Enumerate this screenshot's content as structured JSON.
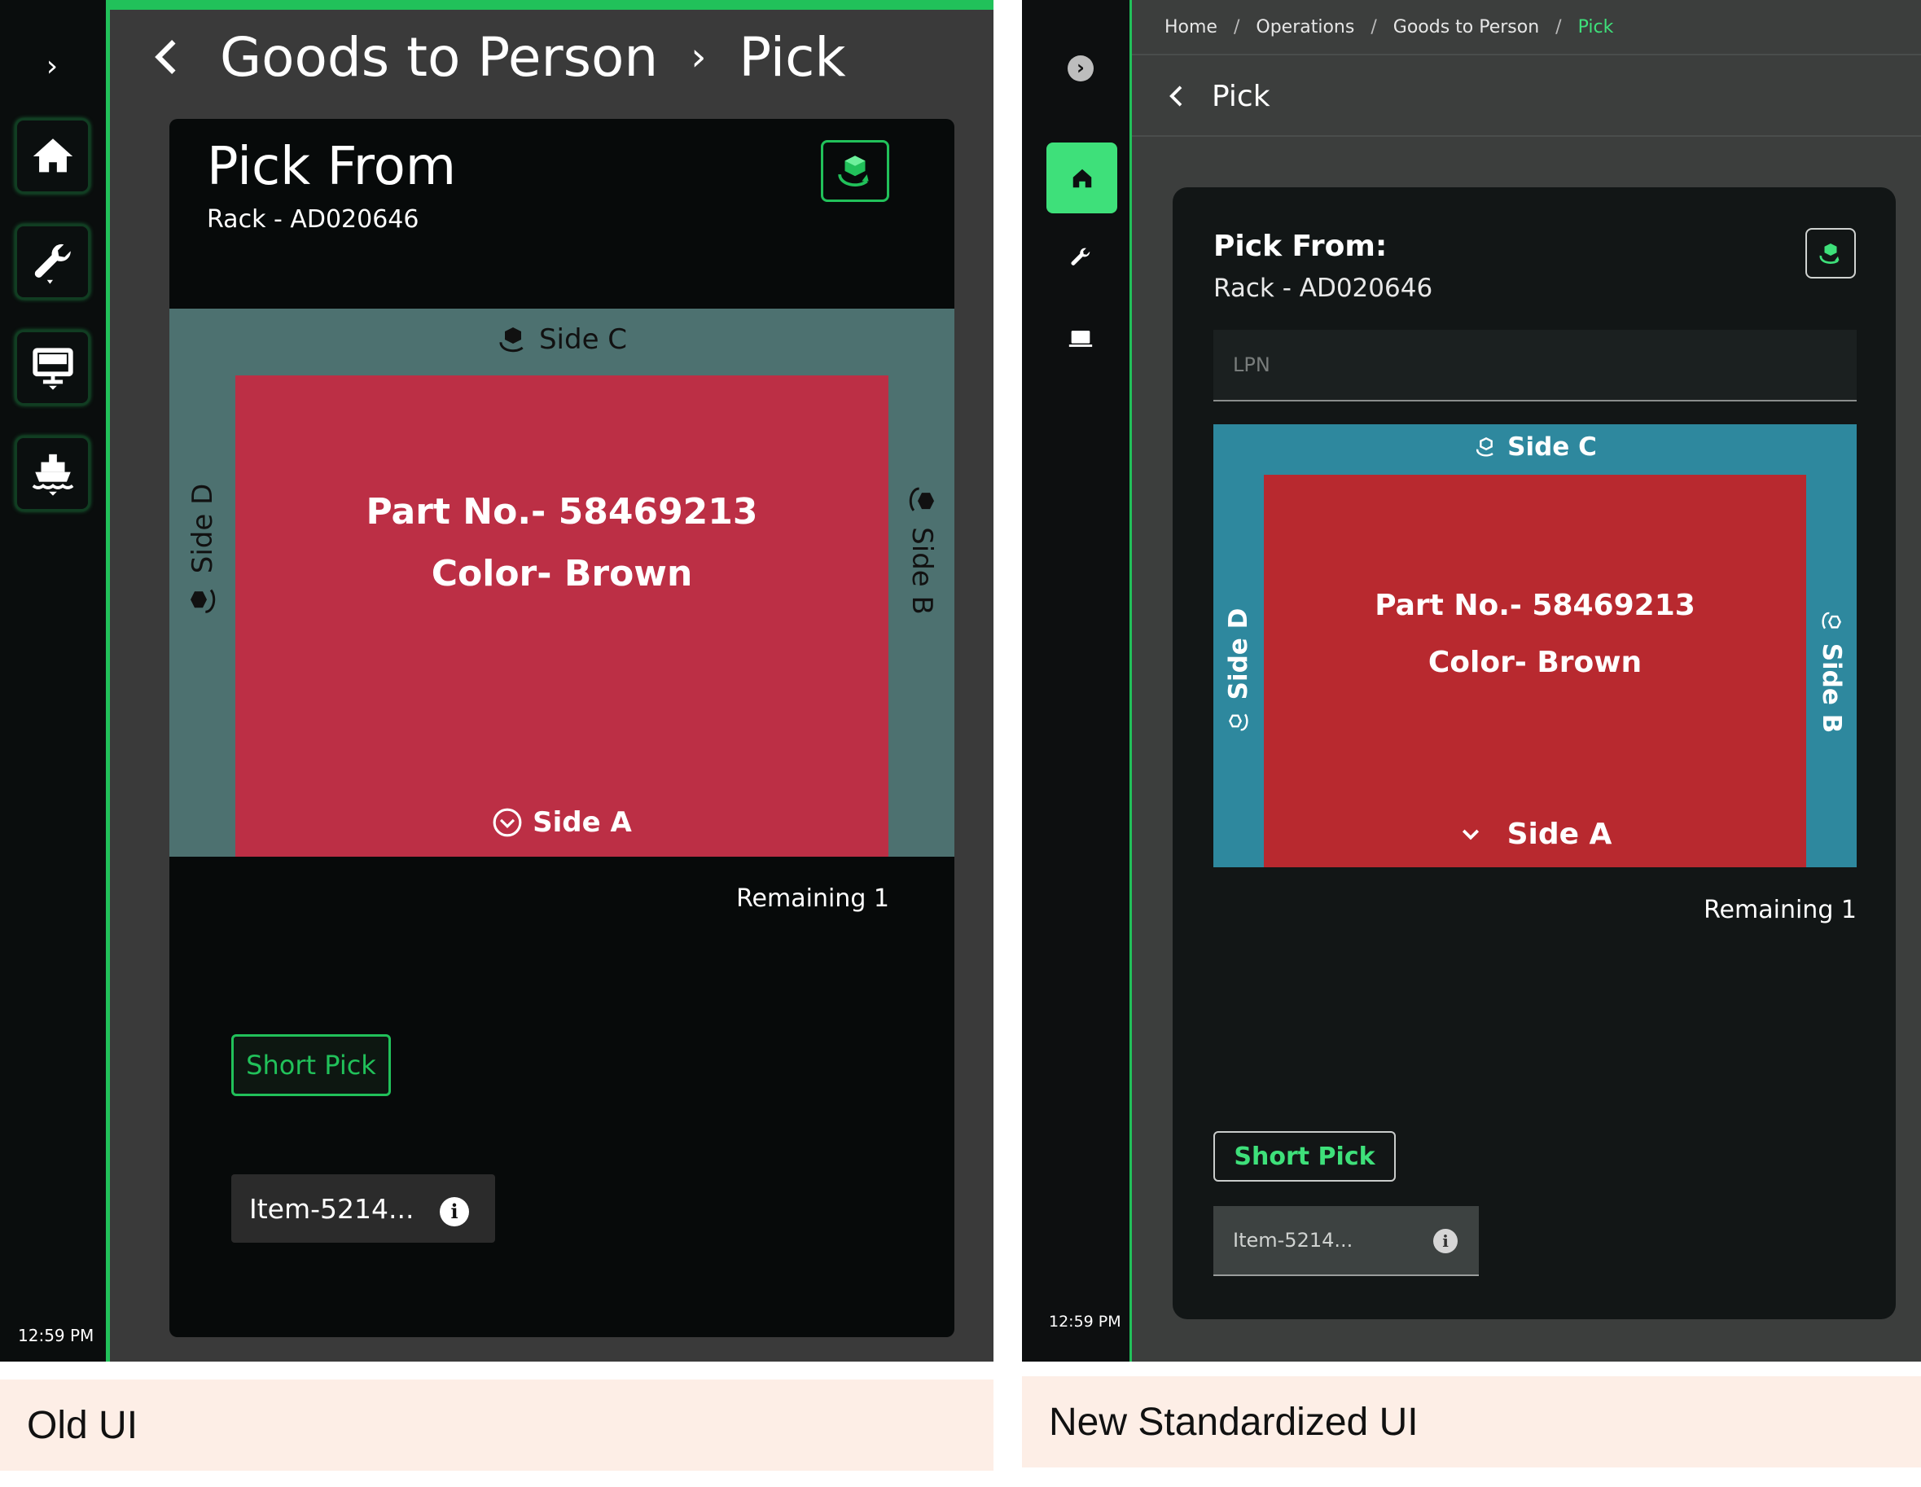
{
  "old_ui": {
    "time": "12:59 PM",
    "header": {
      "section": "Goods to Person",
      "separator": "›",
      "page": "Pick"
    },
    "card": {
      "title": "Pick From",
      "subtitle": "Rack - AD020646",
      "side_c": "Side C",
      "side_d": "Side D",
      "side_b": "Side B",
      "side_a": "Side A",
      "part_no": "Part No.- 58469213",
      "color": "Color- Brown",
      "remaining": "Remaining 1",
      "short_pick": "Short Pick",
      "item_field": "Item-5214..."
    },
    "nav_icons": [
      "home-icon",
      "wrench-icon",
      "monitor-icon",
      "ship-icon"
    ]
  },
  "new_ui": {
    "time": "12:59 PM",
    "breadcrumb": [
      "Home",
      "Operations",
      "Goods to Person",
      "Pick"
    ],
    "breadcrumb_separator": "/",
    "page_title": "Pick",
    "card": {
      "title": "Pick From:",
      "subtitle": "Rack - AD020646",
      "lpn_placeholder": "LPN",
      "side_c": "Side C",
      "side_d": "Side D",
      "side_b": "Side B",
      "side_a": "Side A",
      "part_no": "Part No.- 58469213",
      "color": "Color- Brown",
      "remaining": "Remaining 1",
      "short_pick": "Short Pick",
      "item_field": "Item-5214..."
    },
    "nav_icons": [
      "home-icon",
      "wrench-icon",
      "laptop-icon"
    ]
  },
  "captions": {
    "old": "Old UI",
    "new": "New Standardized UI"
  },
  "colors": {
    "accent_green": "#21c15a",
    "new_accent_green": "#3ee07a",
    "old_rack": "#4d7170",
    "old_part": "#bc2f45",
    "new_rack": "#2e889e",
    "new_part": "#b8292f"
  }
}
